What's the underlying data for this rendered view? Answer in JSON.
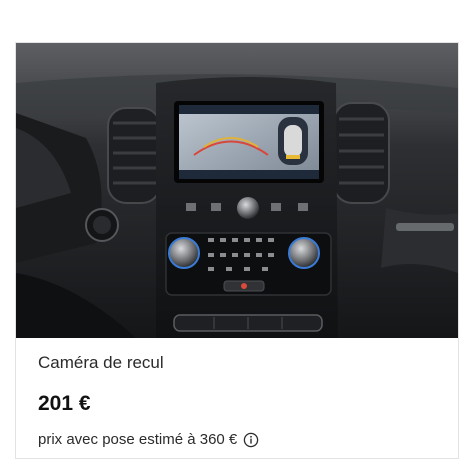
{
  "product": {
    "title": "Caméra de recul",
    "price": "201 €",
    "install_note": "prix avec pose estimé à 360 €"
  },
  "icons": {
    "info": "info-circle-icon"
  },
  "colors": {
    "text_primary": "#2b2b2b",
    "price_text": "#111111",
    "card_border": "#e3e3e3"
  }
}
